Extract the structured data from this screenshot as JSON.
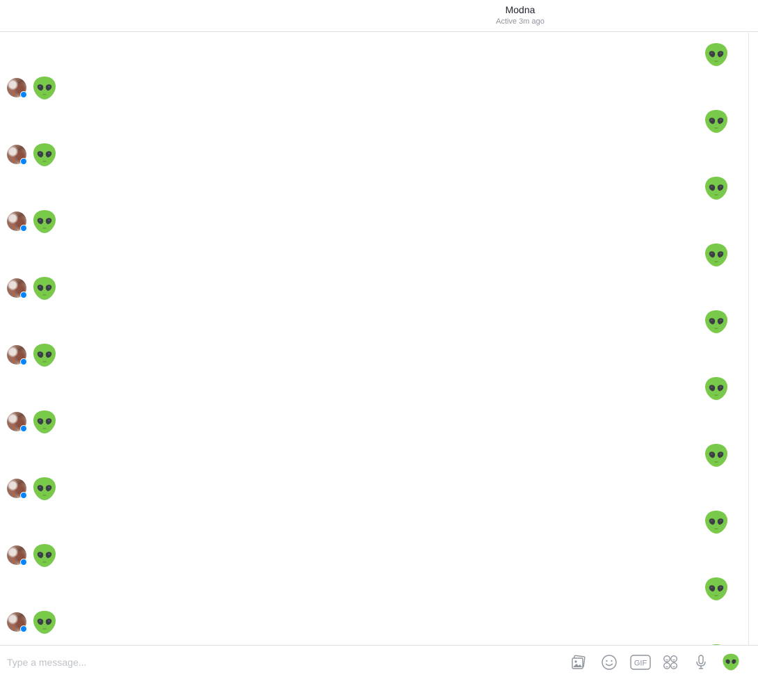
{
  "header": {
    "name": "Modna",
    "status": "Active 3m ago"
  },
  "thread": {
    "message_content": "alien-emoji",
    "sent_count": 10,
    "received_count": 9
  },
  "composer": {
    "placeholder": "Type a message...",
    "gif_label": "GIF",
    "tools": [
      "photo-icon",
      "emoji-icon",
      "gif-icon",
      "sticker-icon",
      "microphone-icon",
      "alien-emoji-send-icon"
    ]
  },
  "colors": {
    "alien_green": "#79c94a",
    "alien_eye": "#3a3f44",
    "messenger_blue": "#0084ff",
    "icon_gray": "#8d949e"
  }
}
